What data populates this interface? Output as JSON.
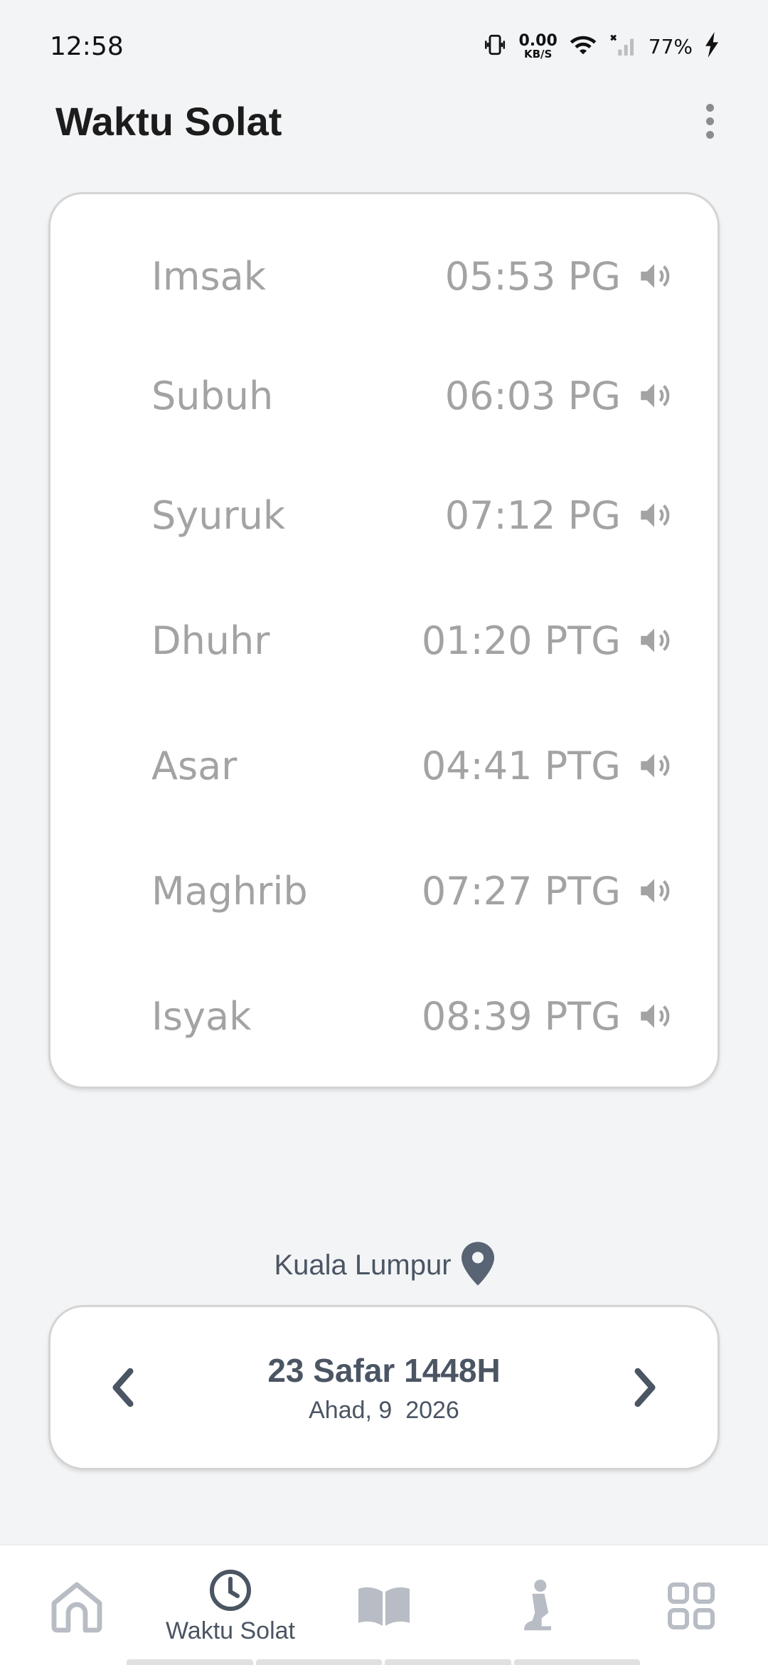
{
  "status_bar": {
    "time": "12:58",
    "network_speed": "0.00",
    "network_unit": "KB/S",
    "battery": "77%"
  },
  "app_bar": {
    "title": "Waktu Solat",
    "menu_icon": "more-vertical-icon"
  },
  "prayers": [
    {
      "name": "Imsak",
      "time": "05:53 PG"
    },
    {
      "name": "Subuh",
      "time": "06:03 PG"
    },
    {
      "name": "Syuruk",
      "time": "07:12 PG"
    },
    {
      "name": "Dhuhr",
      "time": "01:20 PTG"
    },
    {
      "name": "Asar",
      "time": "04:41 PTG"
    },
    {
      "name": "Maghrib",
      "time": "07:27 PTG"
    },
    {
      "name": "Isyak",
      "time": "08:39 PTG"
    }
  ],
  "location": {
    "name": "Kuala Lumpur"
  },
  "date": {
    "hijri": "23 Safar 1448H",
    "gregorian": "Ahad, 9  2026"
  },
  "bottom_nav": {
    "items": [
      {
        "icon": "home-icon",
        "label": ""
      },
      {
        "icon": "clock-icon",
        "label": "Waktu Solat"
      },
      {
        "icon": "book-icon",
        "label": ""
      },
      {
        "icon": "prayer-person-icon",
        "label": ""
      },
      {
        "icon": "grid-icon",
        "label": ""
      }
    ],
    "active_index": 1
  },
  "colors": {
    "background": "#f3f4f6",
    "card": "#ffffff",
    "text_muted": "#a3a3a3",
    "accent_slate": "#4b5563",
    "nav_inactive": "#b8bcc4"
  }
}
